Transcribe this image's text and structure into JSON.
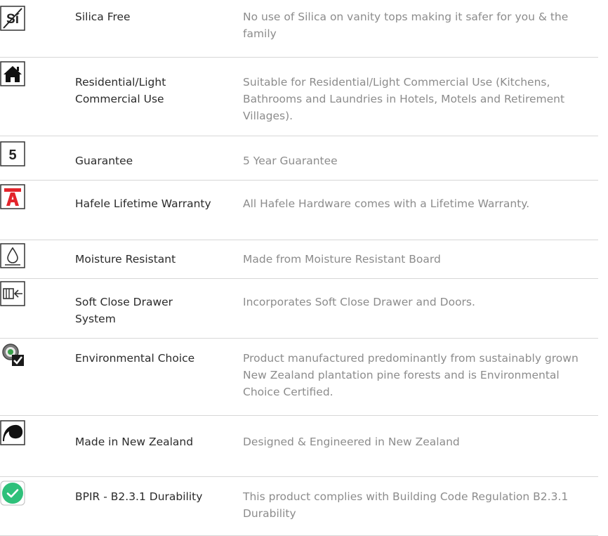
{
  "features": [
    {
      "icon": "silica-free-icon",
      "name": "Silica Free",
      "description": "No use of Silica on vanity tops making it safer for you & the family"
    },
    {
      "icon": "house-icon",
      "name": "Residential/Light Commercial Use",
      "description": "Suitable for Residential/Light Commercial Use (Kitchens, Bathrooms and Laundries in Hotels, Motels and Retirement Villages)."
    },
    {
      "icon": "five-year-icon",
      "name": "Guarantee",
      "description": "5 Year Guarantee",
      "icon_text": "5"
    },
    {
      "icon": "hafele-logo-icon",
      "name": "Hafele Lifetime Warranty",
      "description": "All Hafele Hardware comes with a Lifetime Warranty."
    },
    {
      "icon": "water-drop-icon",
      "name": "Moisture Resistant",
      "description": "Made from Moisture Resistant Board"
    },
    {
      "icon": "soft-close-drawer-icon",
      "name": "Soft Close Drawer System",
      "description": "Incorporates Soft Close Drawer and Doors."
    },
    {
      "icon": "environmental-choice-icon",
      "name": "Environmental Choice",
      "description": "Product manufactured predominantly from sustainably grown New Zealand plantation pine forests and is Environmental Choice Certified."
    },
    {
      "icon": "new-zealand-icon",
      "name": "Made in New Zealand",
      "description": "Designed & Engineered in New Zealand"
    },
    {
      "icon": "check-circle-icon",
      "name": "BPIR - B2.3.1 Durability",
      "description": "This product complies with Building Code Regulation B2.3.1 Durability"
    }
  ],
  "colors": {
    "name_text": "#2b2b2b",
    "desc_text": "#8c8c8c",
    "divider": "#d7d7d7",
    "check_green": "#2fc07a",
    "hafele_red": "#e3242b"
  }
}
